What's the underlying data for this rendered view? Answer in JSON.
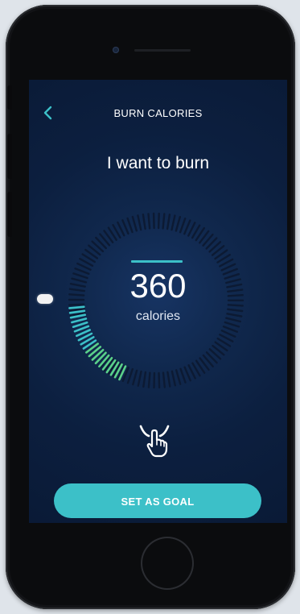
{
  "header": {
    "title": "BURN CALORIES"
  },
  "prompt": {
    "text": "I want to burn"
  },
  "goal": {
    "value": "360",
    "unit": "calories",
    "dial_fraction": 0.26
  },
  "actions": {
    "set_goal_label": "SET AS GOAL"
  },
  "icons": {
    "back": "chevron-left-icon",
    "gesture": "tap-hand-icon"
  },
  "colors": {
    "accent": "#3cc0c8",
    "progress": "#5ad08a",
    "track": "#0c1a33",
    "screen": "#0c1f3f"
  }
}
